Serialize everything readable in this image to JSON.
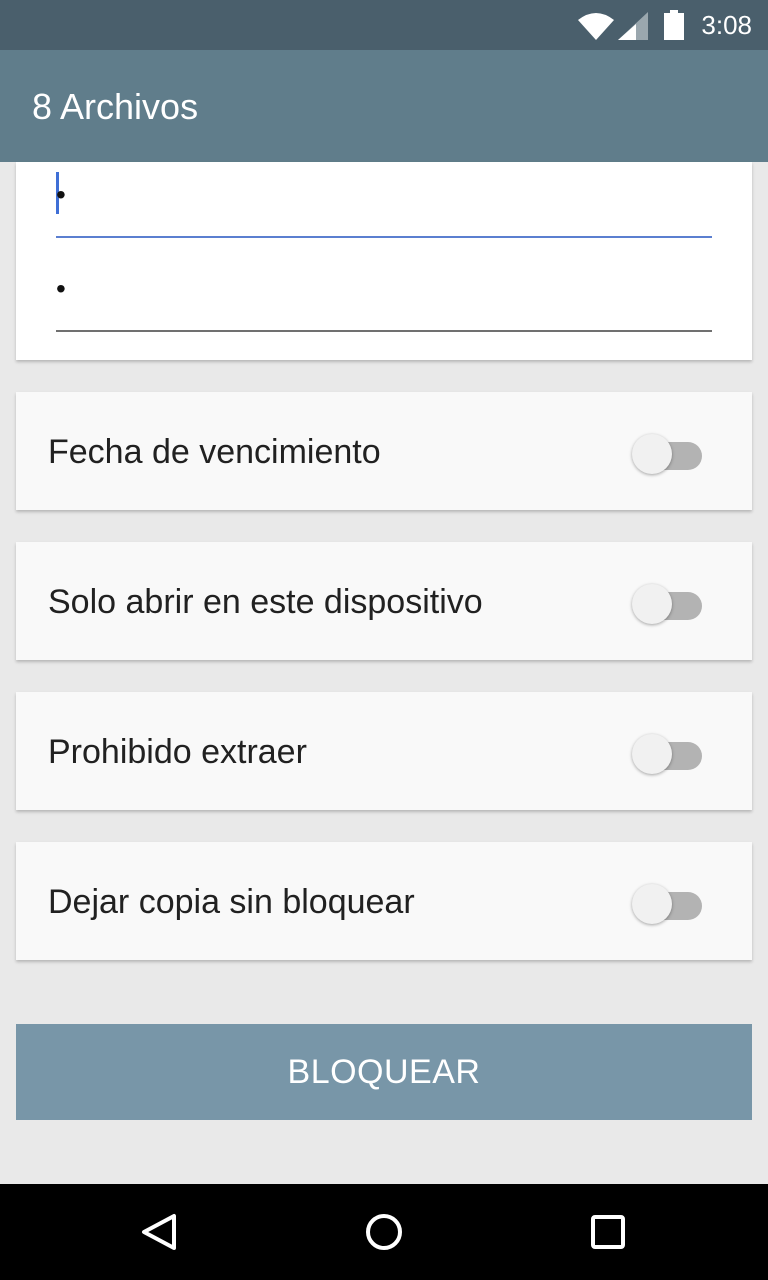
{
  "status_bar": {
    "time": "3:08",
    "icons": [
      "wifi-icon",
      "cell-signal-icon",
      "battery-icon"
    ]
  },
  "app_bar": {
    "title": "8 Archivos"
  },
  "password_fields": [
    {
      "value": "•"
    },
    {
      "value": "•"
    }
  ],
  "options": [
    {
      "label": "Fecha de vencimiento",
      "enabled": false
    },
    {
      "label": "Solo abrir en este dispositivo",
      "enabled": false
    },
    {
      "label": "Prohibido extraer",
      "enabled": false
    },
    {
      "label": "Dejar copia sin bloquear",
      "enabled": false
    }
  ],
  "action": {
    "label": "BLOQUEAR"
  },
  "nav_bar": {
    "icons": [
      "back-icon",
      "home-icon",
      "recents-icon"
    ]
  },
  "colors": {
    "status_bar": "#4a5f6c",
    "app_bar": "#607d8b",
    "button": "#7896a8",
    "background": "#e9e9e9",
    "focus_underline": "#5b7fd0"
  }
}
